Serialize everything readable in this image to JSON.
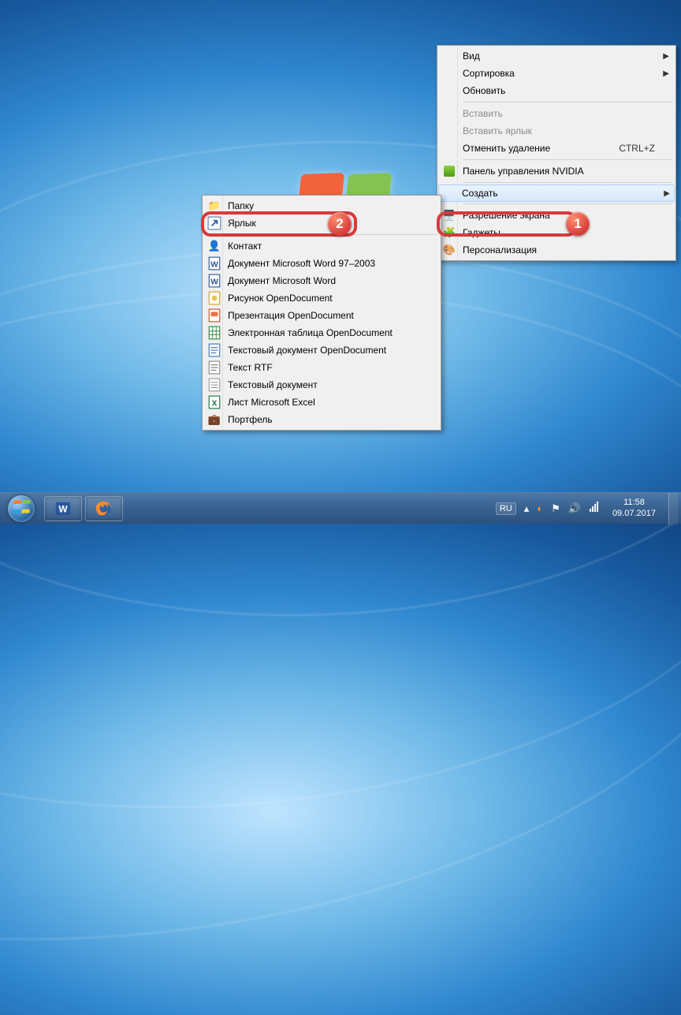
{
  "desktop_menu": {
    "view": "Вид",
    "sort": "Сортировка",
    "refresh": "Обновить",
    "paste": "Вставить",
    "paste_shortcut": "Вставить ярлык",
    "undo_delete": "Отменить удаление",
    "undo_delete_shortcut": "CTRL+Z",
    "nvidia": "Панель управления NVIDIA",
    "create": "Создать",
    "resolution": "Разрешение экрана",
    "gadgets": "Гаджеты",
    "personalize": "Персонализация"
  },
  "create_submenu": {
    "folder": "Папку",
    "shortcut": "Ярлык",
    "contact": "Контакт",
    "word97": "Документ Microsoft Word 97–2003",
    "word": "Документ Microsoft Word",
    "odg": "Рисунок OpenDocument",
    "odp": "Презентация OpenDocument",
    "ods": "Электронная таблица OpenDocument",
    "odt": "Текстовый документ OpenDocument",
    "rtf": "Текст RTF",
    "txt": "Текстовый документ",
    "xls": "Лист Microsoft Excel",
    "briefcase": "Портфель"
  },
  "callout": {
    "one": "1",
    "two": "2"
  },
  "taskbar": {
    "lang": "RU",
    "time": "11:58",
    "date": "09.07.2017"
  }
}
